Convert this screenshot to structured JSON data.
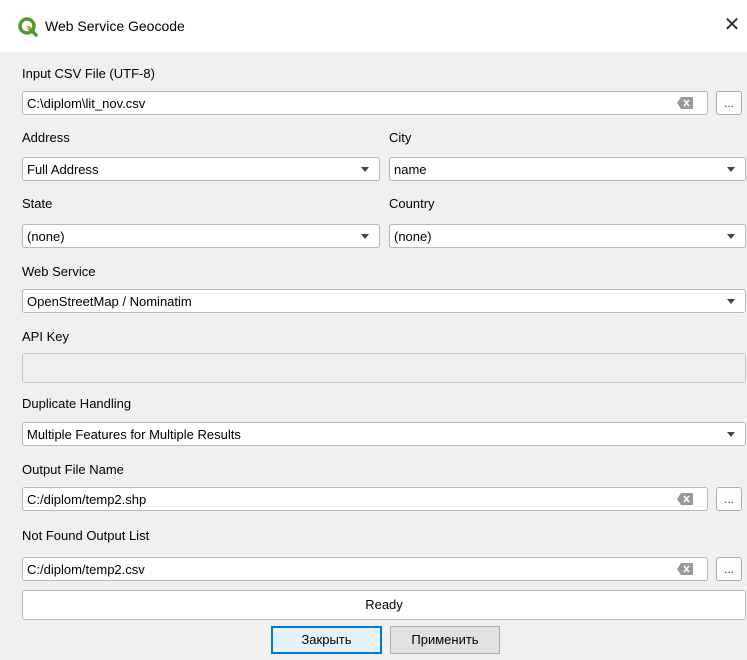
{
  "window": {
    "title": "Web Service Geocode",
    "close_glyph": "✕"
  },
  "input_csv": {
    "label": "Input CSV File (UTF-8)",
    "value": "C:\\diplom\\lit_nov.csv",
    "browse_label": "..."
  },
  "address": {
    "label": "Address",
    "value": "Full Address"
  },
  "city": {
    "label": "City",
    "value": "name"
  },
  "state": {
    "label": "State",
    "value": "(none)"
  },
  "country": {
    "label": "Country",
    "value": "(none)"
  },
  "web_service": {
    "label": "Web Service",
    "value": "OpenStreetMap / Nominatim"
  },
  "api_key": {
    "label": "API Key",
    "value": ""
  },
  "duplicate": {
    "label": "Duplicate Handling",
    "value": "Multiple Features for Multiple Results"
  },
  "output_file": {
    "label": "Output File Name",
    "value": "C:/diplom/temp2.shp",
    "browse_label": "..."
  },
  "not_found": {
    "label": "Not Found Output List",
    "value": "C:/diplom/temp2.csv",
    "browse_label": "..."
  },
  "status": {
    "text": "Ready"
  },
  "buttons": {
    "close_label": "Закрыть",
    "apply_label": "Применить"
  },
  "colors": {
    "app_icon": "#589632",
    "accent": "#0078d7"
  }
}
